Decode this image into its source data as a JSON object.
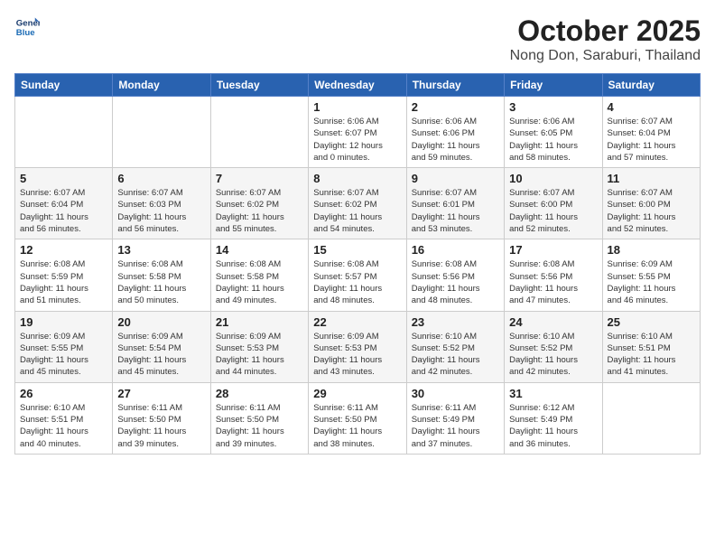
{
  "logo": {
    "line1": "General",
    "line2": "Blue"
  },
  "header": {
    "month": "October 2025",
    "location": "Nong Don, Saraburi, Thailand"
  },
  "weekdays": [
    "Sunday",
    "Monday",
    "Tuesday",
    "Wednesday",
    "Thursday",
    "Friday",
    "Saturday"
  ],
  "weeks": [
    [
      {
        "day": "",
        "info": ""
      },
      {
        "day": "",
        "info": ""
      },
      {
        "day": "",
        "info": ""
      },
      {
        "day": "1",
        "info": "Sunrise: 6:06 AM\nSunset: 6:07 PM\nDaylight: 12 hours\nand 0 minutes."
      },
      {
        "day": "2",
        "info": "Sunrise: 6:06 AM\nSunset: 6:06 PM\nDaylight: 11 hours\nand 59 minutes."
      },
      {
        "day": "3",
        "info": "Sunrise: 6:06 AM\nSunset: 6:05 PM\nDaylight: 11 hours\nand 58 minutes."
      },
      {
        "day": "4",
        "info": "Sunrise: 6:07 AM\nSunset: 6:04 PM\nDaylight: 11 hours\nand 57 minutes."
      }
    ],
    [
      {
        "day": "5",
        "info": "Sunrise: 6:07 AM\nSunset: 6:04 PM\nDaylight: 11 hours\nand 56 minutes."
      },
      {
        "day": "6",
        "info": "Sunrise: 6:07 AM\nSunset: 6:03 PM\nDaylight: 11 hours\nand 56 minutes."
      },
      {
        "day": "7",
        "info": "Sunrise: 6:07 AM\nSunset: 6:02 PM\nDaylight: 11 hours\nand 55 minutes."
      },
      {
        "day": "8",
        "info": "Sunrise: 6:07 AM\nSunset: 6:02 PM\nDaylight: 11 hours\nand 54 minutes."
      },
      {
        "day": "9",
        "info": "Sunrise: 6:07 AM\nSunset: 6:01 PM\nDaylight: 11 hours\nand 53 minutes."
      },
      {
        "day": "10",
        "info": "Sunrise: 6:07 AM\nSunset: 6:00 PM\nDaylight: 11 hours\nand 52 minutes."
      },
      {
        "day": "11",
        "info": "Sunrise: 6:07 AM\nSunset: 6:00 PM\nDaylight: 11 hours\nand 52 minutes."
      }
    ],
    [
      {
        "day": "12",
        "info": "Sunrise: 6:08 AM\nSunset: 5:59 PM\nDaylight: 11 hours\nand 51 minutes."
      },
      {
        "day": "13",
        "info": "Sunrise: 6:08 AM\nSunset: 5:58 PM\nDaylight: 11 hours\nand 50 minutes."
      },
      {
        "day": "14",
        "info": "Sunrise: 6:08 AM\nSunset: 5:58 PM\nDaylight: 11 hours\nand 49 minutes."
      },
      {
        "day": "15",
        "info": "Sunrise: 6:08 AM\nSunset: 5:57 PM\nDaylight: 11 hours\nand 48 minutes."
      },
      {
        "day": "16",
        "info": "Sunrise: 6:08 AM\nSunset: 5:56 PM\nDaylight: 11 hours\nand 48 minutes."
      },
      {
        "day": "17",
        "info": "Sunrise: 6:08 AM\nSunset: 5:56 PM\nDaylight: 11 hours\nand 47 minutes."
      },
      {
        "day": "18",
        "info": "Sunrise: 6:09 AM\nSunset: 5:55 PM\nDaylight: 11 hours\nand 46 minutes."
      }
    ],
    [
      {
        "day": "19",
        "info": "Sunrise: 6:09 AM\nSunset: 5:55 PM\nDaylight: 11 hours\nand 45 minutes."
      },
      {
        "day": "20",
        "info": "Sunrise: 6:09 AM\nSunset: 5:54 PM\nDaylight: 11 hours\nand 45 minutes."
      },
      {
        "day": "21",
        "info": "Sunrise: 6:09 AM\nSunset: 5:53 PM\nDaylight: 11 hours\nand 44 minutes."
      },
      {
        "day": "22",
        "info": "Sunrise: 6:09 AM\nSunset: 5:53 PM\nDaylight: 11 hours\nand 43 minutes."
      },
      {
        "day": "23",
        "info": "Sunrise: 6:10 AM\nSunset: 5:52 PM\nDaylight: 11 hours\nand 42 minutes."
      },
      {
        "day": "24",
        "info": "Sunrise: 6:10 AM\nSunset: 5:52 PM\nDaylight: 11 hours\nand 42 minutes."
      },
      {
        "day": "25",
        "info": "Sunrise: 6:10 AM\nSunset: 5:51 PM\nDaylight: 11 hours\nand 41 minutes."
      }
    ],
    [
      {
        "day": "26",
        "info": "Sunrise: 6:10 AM\nSunset: 5:51 PM\nDaylight: 11 hours\nand 40 minutes."
      },
      {
        "day": "27",
        "info": "Sunrise: 6:11 AM\nSunset: 5:50 PM\nDaylight: 11 hours\nand 39 minutes."
      },
      {
        "day": "28",
        "info": "Sunrise: 6:11 AM\nSunset: 5:50 PM\nDaylight: 11 hours\nand 39 minutes."
      },
      {
        "day": "29",
        "info": "Sunrise: 6:11 AM\nSunset: 5:50 PM\nDaylight: 11 hours\nand 38 minutes."
      },
      {
        "day": "30",
        "info": "Sunrise: 6:11 AM\nSunset: 5:49 PM\nDaylight: 11 hours\nand 37 minutes."
      },
      {
        "day": "31",
        "info": "Sunrise: 6:12 AM\nSunset: 5:49 PM\nDaylight: 11 hours\nand 36 minutes."
      },
      {
        "day": "",
        "info": ""
      }
    ]
  ]
}
